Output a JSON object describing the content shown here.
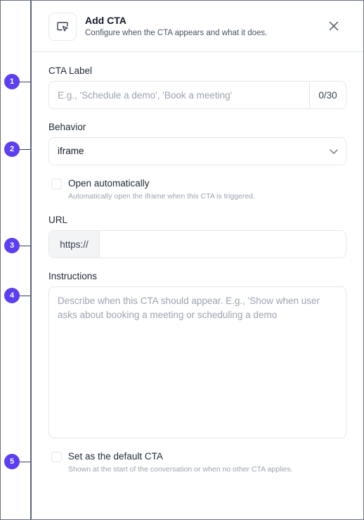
{
  "header": {
    "title": "Add CTA",
    "subtitle": "Configure when the CTA appears and what it does.",
    "icon": "cursor-click-screen-icon",
    "close_icon": "close-icon"
  },
  "cta_label": {
    "label": "CTA Label",
    "placeholder": "E.g., 'Schedule a demo', 'Book a meeting'",
    "value": "",
    "counter": "0/30"
  },
  "behavior": {
    "label": "Behavior",
    "selected": "iframe"
  },
  "open_automatically": {
    "label": "Open automatically",
    "help": "Automatically open the iframe when this CTA is triggered.",
    "checked": false
  },
  "url": {
    "label": "URL",
    "prefix": "https://",
    "value": ""
  },
  "instructions": {
    "label": "Instructions",
    "placeholder": "Describe when this CTA should appear. E.g., 'Show when user asks about booking a meeting or scheduling a demo"
  },
  "default_cta": {
    "label": "Set as the default CTA",
    "help": "Shown at the start of the conversation or when no other CTA applies.",
    "checked": false
  },
  "markers": [
    "1",
    "2",
    "3",
    "4",
    "5"
  ],
  "colors": {
    "marker": "#5b3ff0",
    "border": "#e5e7eb",
    "panel_edge": "#5b6577"
  }
}
